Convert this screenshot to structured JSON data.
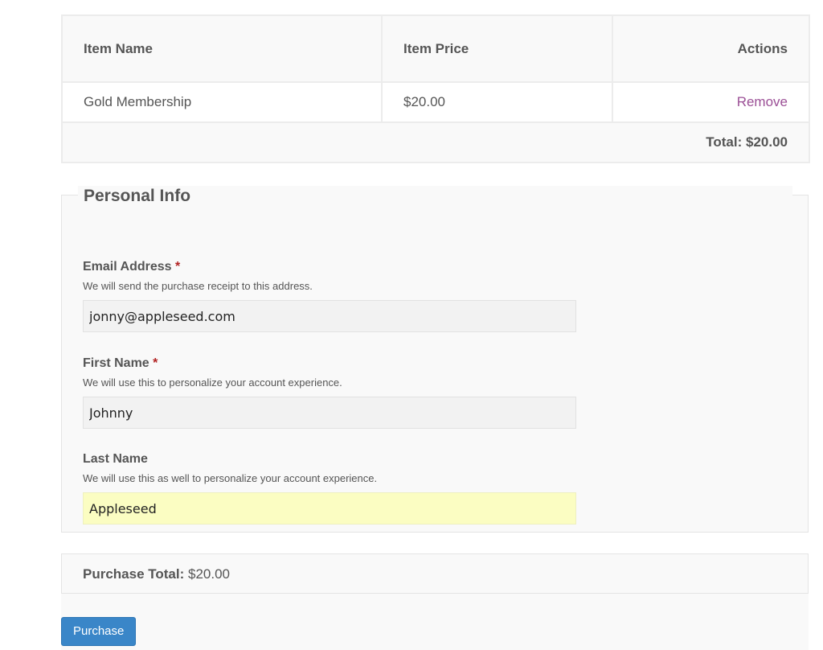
{
  "cart": {
    "headers": {
      "name": "Item Name",
      "price": "Item Price",
      "actions": "Actions"
    },
    "items": [
      {
        "name": "Gold Membership",
        "price": "$20.00",
        "action": "Remove"
      }
    ],
    "total_label": "Total: $20.00"
  },
  "personal_info": {
    "legend": "Personal Info",
    "required_marker": "*",
    "email": {
      "label": "Email Address",
      "description": "We will send the purchase receipt to this address.",
      "value": "jonny@appleseed.com"
    },
    "first_name": {
      "label": "First Name",
      "description": "We will use this to personalize your account experience.",
      "value": "Johnny"
    },
    "last_name": {
      "label": "Last Name",
      "description": "We will use this as well to personalize your account experience.",
      "value": "Appleseed"
    }
  },
  "purchase_total": {
    "label": "Purchase Total:",
    "amount": "$20.00"
  },
  "purchase_button": "Purchase",
  "colors": {
    "link": "#9b4f96",
    "required": "#b22222",
    "button": "#3a86c8",
    "autofill": "#fbfdc2"
  }
}
